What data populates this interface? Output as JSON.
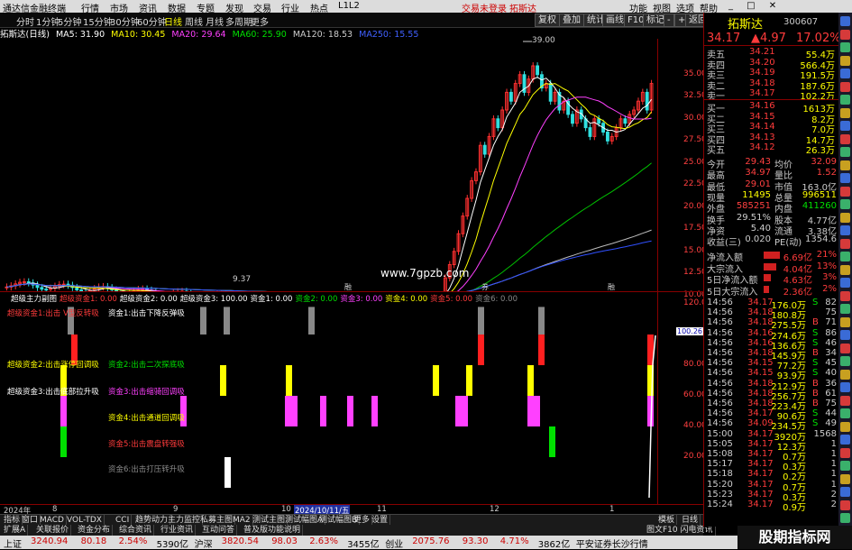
{
  "titlebar": {
    "app": "通达信金融终端",
    "menus": [
      "行情",
      "市场",
      "资讯",
      "数据",
      "专题",
      "发现",
      "交易",
      "行业",
      "热点",
      "L1L2"
    ],
    "trade_login": "交易未登录",
    "stock": "拓斯达",
    "right_menus": [
      "功能",
      "视图",
      "选项",
      "帮助"
    ]
  },
  "toolbar": {
    "periods": [
      "分时",
      "1分钟",
      "5分钟",
      "15分钟",
      "30分钟",
      "60分钟",
      "日线",
      "周线",
      "月线",
      "多周期",
      "更多"
    ],
    "active": "日线",
    "buttons": [
      "复权",
      "叠加",
      "统计",
      "画线",
      "F10",
      "标记",
      "-",
      "+",
      "返回"
    ]
  },
  "maline": {
    "title": "拓斯达(日线)",
    "ma5": "MA5: 31.90",
    "ma10": "MA10: 30.45",
    "ma20": "MA20: 29.64",
    "ma60": "MA60: 25.90",
    "ma120": "MA120: 18.53",
    "ma250": "MA250: 15.55"
  },
  "price_axis": [
    "35.00",
    "32.50",
    "30.00",
    "27.50",
    "25.00",
    "22.50",
    "20.00",
    "17.50",
    "15.00",
    "12.50",
    "10.00"
  ],
  "annotations": {
    "high": "39.00",
    "low": "9.37",
    "watermark": "www.7gpzb.com",
    "markers": [
      "融",
      "券",
      "融"
    ]
  },
  "sub_header": {
    "name": "超级主力副图",
    "items": [
      {
        "text": "超级资金1: 0.00",
        "color": "#ff3b3b"
      },
      {
        "text": "超级资金2: 0.00",
        "color": "#ffffff"
      },
      {
        "text": "超级资金3: 100.00",
        "color": "#ffffff"
      },
      {
        "text": "资金1: 0.00",
        "color": "#ffffff"
      },
      {
        "text": "资金2: 0.00",
        "color": "#00e000"
      },
      {
        "text": "资金3: 0.00",
        "color": "#ff40ff"
      },
      {
        "text": "资金4: 0.00",
        "color": "#ffff00"
      },
      {
        "text": "资金5: 0.00",
        "color": "#ff3b3b"
      },
      {
        "text": "资金6: 0.00",
        "color": "#888888"
      }
    ]
  },
  "sub_labels": [
    {
      "text": "超级资金1:出击 V型反转吸",
      "color": "#ff3b3b"
    },
    {
      "text": "资金1:出击下降反弹吸",
      "color": "#ffffff"
    },
    {
      "text": "超级资金2:出击涨停回调吸",
      "color": "#ffff00"
    },
    {
      "text": "资金2:出击二次探底吸",
      "color": "#00e000"
    },
    {
      "text": "超级资金3:出击底部拉升吸",
      "color": "#ffffff"
    },
    {
      "text": "资金3:出击缩骑回调吸",
      "color": "#ff40ff"
    },
    {
      "text": "资金4:出击通道回调吸",
      "color": "#ffff00"
    },
    {
      "text": "资金5:出击震盘转强吸",
      "color": "#ff3b3b"
    },
    {
      "text": "资金6:出击打压转升吸",
      "color": "#888888"
    }
  ],
  "sub_axis": [
    "120.00",
    "100.00",
    "80.00",
    "60.00",
    "40.00",
    "20.00"
  ],
  "sub_current": "100.26",
  "date_axis": [
    "2024年",
    "8",
    "9",
    "10",
    "2024/10/11/五",
    "11",
    "12",
    "1"
  ],
  "quote": {
    "name": "拓斯达",
    "code": "300607",
    "price": "34.17",
    "change": "▲4.97",
    "pct": "17.02%",
    "asks": [
      {
        "label": "卖五",
        "price": "34.21",
        "vol": "55.4万"
      },
      {
        "label": "卖四",
        "price": "34.20",
        "vol": "566.4万"
      },
      {
        "label": "卖三",
        "price": "34.19",
        "vol": "191.5万"
      },
      {
        "label": "卖二",
        "price": "34.18",
        "vol": "187.6万"
      },
      {
        "label": "卖一",
        "price": "34.17",
        "vol": "102.2万"
      }
    ],
    "bids": [
      {
        "label": "买一",
        "price": "34.16",
        "vol": "1613万"
      },
      {
        "label": "买二",
        "price": "34.15",
        "vol": "8.2万"
      },
      {
        "label": "买三",
        "price": "34.14",
        "vol": "7.0万"
      },
      {
        "label": "买四",
        "price": "34.13",
        "vol": "14.7万"
      },
      {
        "label": "买五",
        "price": "34.12",
        "vol": "26.3万"
      }
    ],
    "stats": [
      {
        "l1": "今开",
        "v1": "29.43",
        "l2": "均价",
        "v2": "32.09"
      },
      {
        "l1": "最高",
        "v1": "34.97",
        "l2": "量比",
        "v2": "1.52"
      },
      {
        "l1": "最低",
        "v1": "29.01",
        "l2": "市值",
        "v2": "163.0亿"
      },
      {
        "l1": "现量",
        "v1": "11495",
        "l2": "总量",
        "v2": "996511"
      },
      {
        "l1": "外盘",
        "v1": "585251",
        "l2": "内盘",
        "v2": "411260"
      },
      {
        "l1": "换手",
        "v1": "29.51%",
        "l2": "股本",
        "v2": "4.77亿"
      },
      {
        "l1": "净资",
        "v1": "5.40",
        "l2": "流通",
        "v2": "3.38亿"
      },
      {
        "l1": "收益(三)",
        "v1": "0.020",
        "l2": "PE(动)",
        "v2": "1354.6"
      }
    ],
    "flows": [
      {
        "label": "净流入额",
        "val": "6.69亿",
        "pct": "21%"
      },
      {
        "label": "大宗流入",
        "val": "4.04亿",
        "pct": "13%"
      },
      {
        "label": "5日净流入额",
        "val": "4.63亿",
        "pct": "3%"
      },
      {
        "label": "5日大宗流入",
        "val": "2.36亿",
        "pct": "2%"
      }
    ],
    "ticks": [
      {
        "t": "14:56",
        "p": "34.17",
        "v": "176.0万",
        "d": "S",
        "n": "82"
      },
      {
        "t": "14:56",
        "p": "34.18",
        "v": "180.8万",
        "d": "",
        "n": "75"
      },
      {
        "t": "14:56",
        "p": "34.18",
        "v": "275.5万",
        "d": "B",
        "n": "71"
      },
      {
        "t": "14:56",
        "p": "34.16",
        "v": "274.6万",
        "d": "S",
        "n": "86"
      },
      {
        "t": "14:56",
        "p": "34.16",
        "v": "136.6万",
        "d": "S",
        "n": "46"
      },
      {
        "t": "14:56",
        "p": "34.18",
        "v": "145.9万",
        "d": "B",
        "n": "34"
      },
      {
        "t": "14:56",
        "p": "34.15",
        "v": "77.2万",
        "d": "S",
        "n": "45"
      },
      {
        "t": "14:56",
        "p": "34.15",
        "v": "93.9万",
        "d": "S",
        "n": "40"
      },
      {
        "t": "14:56",
        "p": "34.18",
        "v": "212.9万",
        "d": "B",
        "n": "36"
      },
      {
        "t": "14:56",
        "p": "34.18",
        "v": "256.7万",
        "d": "B",
        "n": "61"
      },
      {
        "t": "14:56",
        "p": "34.18",
        "v": "223.4万",
        "d": "B",
        "n": "75"
      },
      {
        "t": "14:56",
        "p": "34.17",
        "v": "90.6万",
        "d": "S",
        "n": "44"
      },
      {
        "t": "14:56",
        "p": "34.09",
        "v": "234.5万",
        "d": "S",
        "n": "49"
      },
      {
        "t": "15:00",
        "p": "34.17",
        "v": "3920万",
        "d": "",
        "n": "1568"
      },
      {
        "t": "15:05",
        "p": "34.17",
        "v": "12.3万",
        "d": "",
        "n": "1"
      },
      {
        "t": "15:08",
        "p": "34.17",
        "v": "0.7万",
        "d": "",
        "n": "1"
      },
      {
        "t": "15:17",
        "p": "34.17",
        "v": "0.3万",
        "d": "",
        "n": "1"
      },
      {
        "t": "15:18",
        "p": "34.17",
        "v": "0.2万",
        "d": "",
        "n": "1"
      },
      {
        "t": "15:20",
        "p": "34.17",
        "v": "0.7万",
        "d": "",
        "n": "1"
      },
      {
        "t": "15:23",
        "p": "34.17",
        "v": "0.3万",
        "d": "",
        "n": "2"
      },
      {
        "t": "15:24",
        "p": "34.17",
        "v": "0.9万",
        "d": "",
        "n": "2"
      }
    ]
  },
  "tabs": [
    "指标",
    "窗口",
    "MACD",
    "VOL-TDX",
    "CCI",
    "趋势动力",
    "主力监控",
    "私募主图",
    "MA2",
    "测试主图",
    "测试幅图A",
    "测试幅图B",
    "更多",
    "设置"
  ],
  "tabs_right": "模板",
  "tabs_right2": "日线",
  "tabs2": [
    "扩展A",
    "关联报价",
    "资金分布",
    "综合资讯",
    "行业资讯",
    "互动问答",
    "普及版功能说明"
  ],
  "tabs2_right": "图文F10 闪电资讯",
  "ticker": [
    {
      "text": "上证",
      "color": "#000"
    },
    {
      "text": "3240.94",
      "color": "#c00"
    },
    {
      "text": "80.18",
      "color": "#c00"
    },
    {
      "text": "2.54%",
      "color": "#c00"
    },
    {
      "text": "5390亿",
      "color": "#000"
    },
    {
      "text": "沪深",
      "color": "#000"
    },
    {
      "text": "3820.54",
      "color": "#c00"
    },
    {
      "text": "98.03",
      "color": "#c00"
    },
    {
      "text": "2.63%",
      "color": "#c00"
    },
    {
      "text": "3455亿",
      "color": "#000"
    },
    {
      "text": "创业",
      "color": "#000"
    },
    {
      "text": "2075.76",
      "color": "#c00"
    },
    {
      "text": "93.30",
      "color": "#c00"
    },
    {
      "text": "4.71%",
      "color": "#c00"
    },
    {
      "text": "3862亿",
      "color": "#000"
    },
    {
      "text": "平安证券长沙行情",
      "color": "#000"
    }
  ],
  "watermark_text": "股期指标网"
}
